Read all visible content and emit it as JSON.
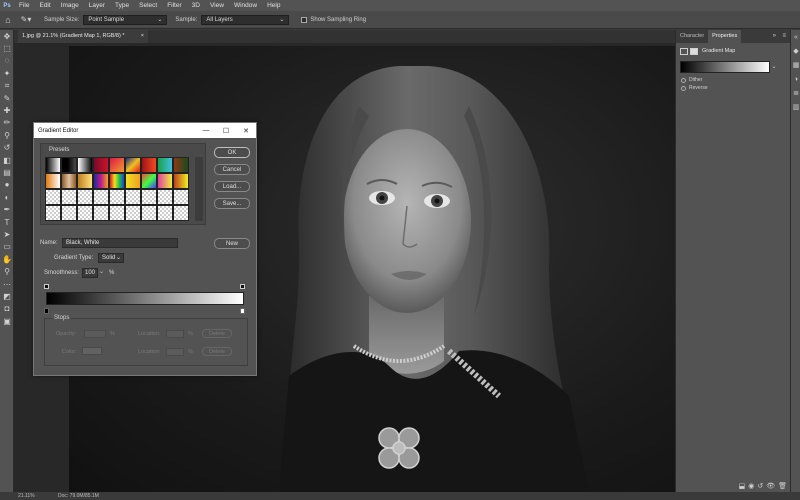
{
  "menubar": {
    "logo": "Ps",
    "items": [
      "File",
      "Edit",
      "Image",
      "Layer",
      "Type",
      "Select",
      "Filter",
      "3D",
      "View",
      "Window",
      "Help"
    ]
  },
  "options_bar": {
    "sample_size_label": "Sample Size:",
    "sample_size_value": "Point Sample",
    "sample_label": "Sample:",
    "sample_value": "All Layers",
    "show_ring_label": "Show Sampling Ring"
  },
  "document_tab": {
    "title": "1.jpg @ 21.1% (Gradient Map 1, RGB/8) *",
    "close": "×"
  },
  "dialog": {
    "title": "Gradient Editor",
    "presets_label": "Presets",
    "ok": "OK",
    "cancel": "Cancel",
    "load": "Load...",
    "save": "Save...",
    "new": "New",
    "name_label": "Name:",
    "name_value": "Black, White",
    "gradient_type_label": "Gradient Type:",
    "gradient_type_value": "Solid",
    "smoothness_label": "Smoothness:",
    "smoothness_value": "100",
    "smoothness_unit": "%",
    "stops_label": "Stops",
    "opacity_label": "Opacity:",
    "color_label": "Color:",
    "location_label": "Location:",
    "percent": "%",
    "delete": "Delete"
  },
  "properties_panel": {
    "tab_character": "Character",
    "tab_properties": "Properties",
    "adjustment_name": "Gradient Map",
    "dither_label": "Dither",
    "reverse_label": "Reverse",
    "gradient_colors": [
      "#000000",
      "#ffffff"
    ]
  },
  "status_bar": {
    "zoom": "21.11%",
    "doc_size": "Doc: 79.0M/85.1M"
  },
  "presets_swatches": [
    "linear-gradient(90deg,#000,#fff)",
    "linear-gradient(90deg,#000,#000 40%,transparent)",
    "linear-gradient(90deg,#fff,#000)",
    "linear-gradient(90deg,#7a0a2a,#c8142a)",
    "linear-gradient(135deg,#e0144a,#f0a028)",
    "linear-gradient(135deg,#1a2a8a,#f0c020,#e01a1a)",
    "linear-gradient(90deg,#a01418,#f04a20)",
    "linear-gradient(90deg,#1aa04a,#40c0e0)",
    "linear-gradient(90deg,#8a3a18,#1a4a1a)",
    "linear-gradient(90deg,#e07a10,#fff)",
    "linear-gradient(90deg,#8a5a2a,#e0c0a0,#8a5a2a)",
    "linear-gradient(90deg,#c08020,#ffe080)",
    "linear-gradient(90deg,#1a2aa0,#c01a8a,#f0a020)",
    "linear-gradient(90deg,#e01a1a,#f0e020,#20c040,#2040e0)",
    "linear-gradient(90deg,#f0e020,#f0a020)",
    "linear-gradient(135deg,#ff4040,#40ff40,#4040ff)",
    "linear-gradient(90deg,#e040a0,#f0f040)",
    "linear-gradient(90deg,#c04020,#f0f020)",
    "checker",
    "checker",
    "checker",
    "checker",
    "checker",
    "checker",
    "checker",
    "checker",
    "checker",
    "checker",
    "checker",
    "checker",
    "checker",
    "checker",
    "checker",
    "checker",
    "checker",
    "checker"
  ]
}
